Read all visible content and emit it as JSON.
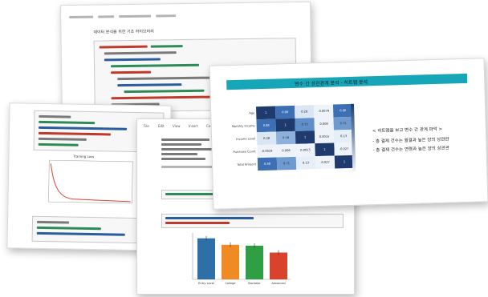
{
  "slide_back": {
    "heading": "데이터 분석을 위한 기초 라이브러리"
  },
  "slide_right": {
    "title": "변수 간 상관관계 분석 - 히트맵 분석",
    "notes": [
      "< 히트맵을 보고 변수 간 관계 파악 >",
      "- 총 결제 건수는 월결과 높은 양의 상관관",
      "- 총 결제 건수는 연령과 높은 양의 상관관"
    ],
    "heatmap": {
      "row_labels": [
        "Age",
        "Monthly Income",
        "Income Level",
        "Purchase Count",
        "Total Amount"
      ],
      "cells": [
        [
          "1",
          "0.88",
          "0.28",
          "-0.0079",
          "0.88"
        ],
        [
          "0.88",
          "1",
          "0.73",
          "0.008",
          "0.71"
        ],
        [
          "0.28",
          "0.58",
          "1",
          "0.0015",
          "0.13"
        ],
        [
          "-0.0024",
          "0.008",
          "0.0015",
          "1",
          "-0.027"
        ],
        [
          "0.88",
          "0.71",
          "0.13",
          "-0.027",
          "1"
        ]
      ],
      "colors": [
        [
          "#1f3b6e",
          "#3d6fb5",
          "#dbe6f4",
          "#eef3fa",
          "#3d6fb5"
        ],
        [
          "#3d6fb5",
          "#1f3b6e",
          "#5f8fca",
          "#eef3fa",
          "#6f9ad0"
        ],
        [
          "#dbe6f4",
          "#8db0dc",
          "#1f3b6e",
          "#eef3fa",
          "#e6eef8"
        ],
        [
          "#eef3fa",
          "#eef3fa",
          "#eef3fa",
          "#1f3b6e",
          "#eef3fa"
        ],
        [
          "#3d6fb5",
          "#6f9ad0",
          "#e6eef8",
          "#eef3fa",
          "#1f3b6e"
        ]
      ]
    },
    "colors": {
      "title_bar": "#17a6b8"
    }
  },
  "slide_left": {
    "chart_title": "Training Loss"
  },
  "slide_center": {
    "menu": [
      "File",
      "Edit",
      "View",
      "Insert",
      "Cell",
      "Kernel",
      "Help"
    ],
    "bar_colors": [
      "#2f6fa8",
      "#f08a24",
      "#2f9e44",
      "#d9422b"
    ],
    "bar_values": [
      0.95,
      0.8,
      0.78,
      0.62
    ],
    "bar_labels": [
      "Entry Level",
      "College",
      "Bachelor",
      "Advanced"
    ]
  }
}
